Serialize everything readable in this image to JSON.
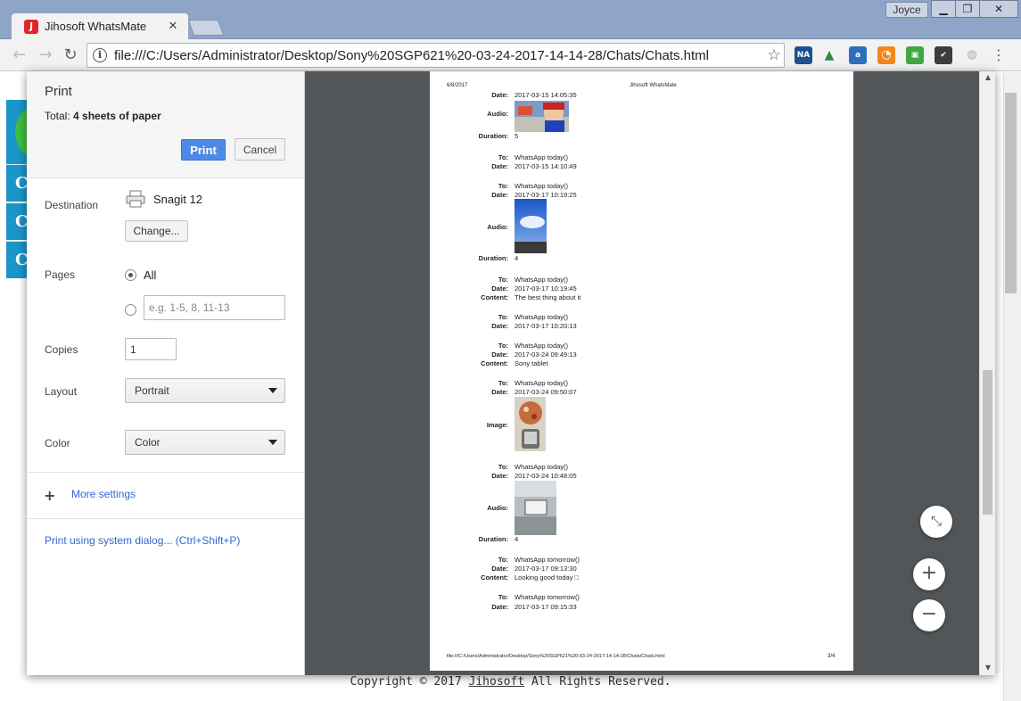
{
  "browser": {
    "tab_title": "Jihosoft WhatsMate",
    "user": "Joyce",
    "url": "file:///C:/Users/Administrator/Desktop/Sony%20SGP621%20-03-24-2017-14-14-28/Chats/Chats.html",
    "ext_badge": "NA"
  },
  "background": {
    "sidebar_letters": [
      "C",
      "C",
      "C"
    ],
    "copyright_prefix": "Copyright © 2017 ",
    "copyright_link": "Jihosoft",
    "copyright_suffix": " All Rights Reserved."
  },
  "print": {
    "title": "Print",
    "total_label": "Total: ",
    "total_value": "4 sheets of paper",
    "print_button": "Print",
    "cancel_button": "Cancel",
    "destination_label": "Destination",
    "destination_name": "Snagit 12",
    "change_button": "Change...",
    "pages_label": "Pages",
    "pages_all": "All",
    "pages_placeholder": "e.g. 1-5, 8, 11-13",
    "copies_label": "Copies",
    "copies_value": "1",
    "layout_label": "Layout",
    "layout_value": "Portrait",
    "color_label": "Color",
    "color_value": "Color",
    "more_settings": "More settings",
    "system_dialog": "Print using system dialog... (Ctrl+Shift+P)"
  },
  "preview": {
    "header_date": "6/8/2017",
    "header_title": "Jihosoft WhatsMate",
    "footer_url": "file:///C:/Users/Administrator/Desktop/Sony%20SGP621%20-03-24-2017-14-14-28/Chats/Chats.html",
    "footer_page": "3/4",
    "rows": [
      {
        "k": "Date:",
        "v": "2017-03-15 14:05:35"
      },
      {
        "k": "Audio:",
        "v": ""
      },
      {
        "k": "Duration:",
        "v": "5"
      },
      {
        "k": "To:",
        "v": "WhatsApp today()"
      },
      {
        "k": "Date:",
        "v": "2017-03-15 14:10:49"
      },
      {
        "k": "To:",
        "v": "WhatsApp today()"
      },
      {
        "k": "Date:",
        "v": "2017-03-17 10:19:25"
      },
      {
        "k": "Audio:",
        "v": ""
      },
      {
        "k": "Duration:",
        "v": "4"
      },
      {
        "k": "To:",
        "v": "WhatsApp today()"
      },
      {
        "k": "Date:",
        "v": "2017-03-17 10:19:45"
      },
      {
        "k": "Content:",
        "v": "The best thing about it"
      },
      {
        "k": "To:",
        "v": "WhatsApp today()"
      },
      {
        "k": "Date:",
        "v": "2017-03-17 10:20:13"
      },
      {
        "k": "To:",
        "v": "WhatsApp today()"
      },
      {
        "k": "Date:",
        "v": "2017-03-24 09:49:13"
      },
      {
        "k": "Content:",
        "v": "Sony tablet"
      },
      {
        "k": "To:",
        "v": "WhatsApp today()"
      },
      {
        "k": "Date:",
        "v": "2017-03-24 09:50:07"
      },
      {
        "k": "Image:",
        "v": ""
      },
      {
        "k": "To:",
        "v": "WhatsApp today()"
      },
      {
        "k": "Date:",
        "v": "2017-03-24 10:48:05"
      },
      {
        "k": "Audio:",
        "v": ""
      },
      {
        "k": "Duration:",
        "v": "4"
      },
      {
        "k": "To:",
        "v": "WhatsApp tomorrow()"
      },
      {
        "k": "Date:",
        "v": "2017-03-17 09:13:30"
      },
      {
        "k": "Content:",
        "v": "Looking good today □"
      },
      {
        "k": "To:",
        "v": "WhatsApp tomorrow()"
      },
      {
        "k": "Date:",
        "v": "2017-03-17 09:15:33"
      }
    ]
  },
  "colors": {
    "accent": "#4d8ae8",
    "link": "#3367d6",
    "preview_bg": "#525659",
    "sidebar_blue": "#1a96c8"
  }
}
